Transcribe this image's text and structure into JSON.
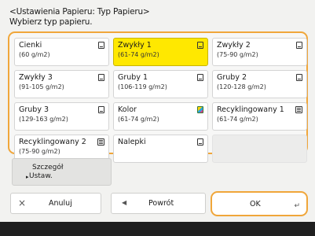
{
  "header": {
    "title": "<Ustawienia Papieru: Typ Papieru>",
    "instruction": "Wybierz typ papieru."
  },
  "paper_types": [
    {
      "name": "Cienki",
      "weight": "(60 g/m2)",
      "icon": "paper-icon",
      "selected": false
    },
    {
      "name": "Zwykły 1",
      "weight": "(61-74 g/m2)",
      "icon": "paper-icon",
      "selected": true
    },
    {
      "name": "Zwykły 2",
      "weight": "(75-90 g/m2)",
      "icon": "paper-icon",
      "selected": false
    },
    {
      "name": "Zwykły 3",
      "weight": "(91-105 g/m2)",
      "icon": "paper-icon",
      "selected": false
    },
    {
      "name": "Gruby 1",
      "weight": "(106-119 g/m2)",
      "icon": "paper-icon",
      "selected": false
    },
    {
      "name": "Gruby 2",
      "weight": "(120-128 g/m2)",
      "icon": "paper-icon",
      "selected": false
    },
    {
      "name": "Gruby 3",
      "weight": "(129-163 g/m2)",
      "icon": "paper-icon",
      "selected": false
    },
    {
      "name": "Kolor",
      "weight": "(61-74 g/m2)",
      "icon": "color-paper-icon",
      "selected": false
    },
    {
      "name": "Recyklingowany 1",
      "weight": "(61-74 g/m2)",
      "icon": "recycled-paper-icon",
      "selected": false
    },
    {
      "name": "Recyklingowany 2",
      "weight": "(75-90 g/m2)",
      "icon": "recycled-paper-icon",
      "selected": false
    },
    {
      "name": "Nalepki",
      "weight": "",
      "icon": "paper-icon",
      "selected": false
    }
  ],
  "detail_button": {
    "line1": "Szczegół",
    "line2": "Ustaw."
  },
  "buttons": {
    "cancel": {
      "label": "Anuluj",
      "icon": "close-icon"
    },
    "back": {
      "label": "Powrót",
      "icon": "back-arrow-icon"
    },
    "ok": {
      "label": "OK",
      "icon": "enter-icon"
    }
  },
  "colors": {
    "accent": "#f0a63a",
    "selected": "#ffe800"
  }
}
